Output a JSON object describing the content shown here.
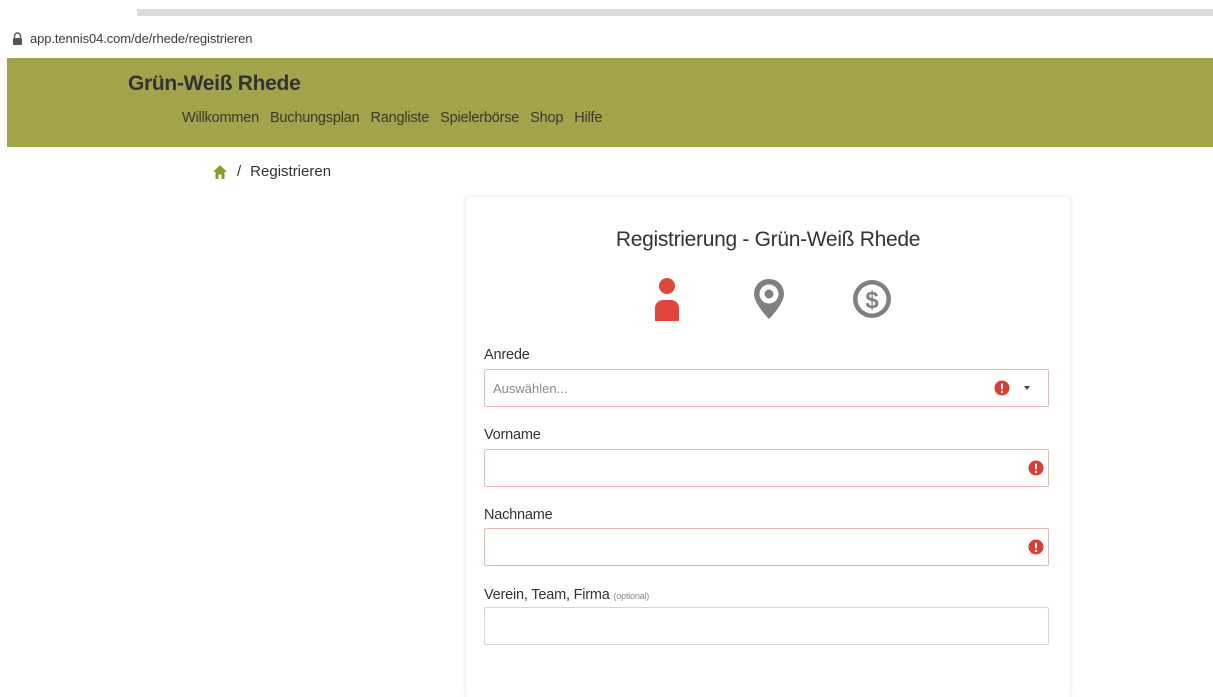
{
  "browser": {
    "url": "app.tennis04.com/de/rhede/registrieren"
  },
  "header": {
    "brand": "Grün-Weiß Rhede",
    "nav": [
      "Willkommen",
      "Buchungsplan",
      "Rangliste",
      "Spielerbörse",
      "Shop",
      "Hilfe"
    ]
  },
  "breadcrumb": {
    "separator": "/",
    "current": "Registrieren"
  },
  "form": {
    "title": "Registrierung - Grün-Weiß Rhede",
    "steps": [
      "person-icon",
      "location-pin-icon",
      "dollar-icon"
    ],
    "fields": {
      "anrede": {
        "label": "Anrede",
        "placeholder": "Auswählen..."
      },
      "vorname": {
        "label": "Vorname",
        "value": ""
      },
      "nachname": {
        "label": "Nachname",
        "value": ""
      },
      "verein": {
        "label": "Verein, Team, Firma",
        "optional": "(optional)",
        "value": ""
      }
    }
  },
  "colors": {
    "header_bg": "#a1a44b",
    "home_icon": "#8e9b2e",
    "active_step": "#e0463c",
    "inactive_step": "#808080",
    "error": "#dc3d30",
    "error_border": "#e8b9b3"
  }
}
